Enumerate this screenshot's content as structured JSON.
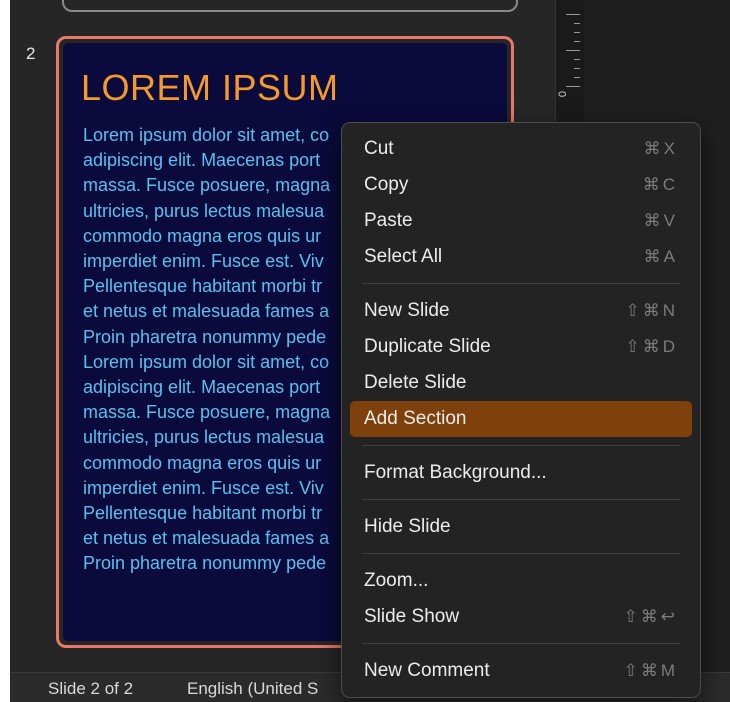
{
  "navigator": {
    "slide_number": "2",
    "slide_title": "LOREM IPSUM",
    "slide_body_lines": [
      "Lorem ipsum dolor sit amet, co",
      "adipiscing elit. Maecenas port",
      "massa. Fusce posuere, magna",
      "ultricies, purus lectus malesua",
      "commodo magna eros quis ur",
      "imperdiet enim. Fusce est. Viv",
      "Pellentesque habitant morbi tr",
      "et netus et malesuada fames a",
      "Proin pharetra nonummy pede",
      "Lorem ipsum dolor sit amet, co",
      "adipiscing elit. Maecenas port",
      "massa. Fusce posuere, magna",
      "ultricies, purus lectus malesua",
      "commodo magna eros quis ur",
      "imperdiet enim. Fusce est. Viv",
      "Pellentesque habitant morbi tr",
      "et netus et malesuada fames a",
      "Proin pharetra nonummy pede"
    ]
  },
  "ruler": {
    "zero_label": "0"
  },
  "status_bar": {
    "slide_count": "Slide 2 of 2",
    "language": "English (United S"
  },
  "context_menu": {
    "groups": [
      [
        {
          "label": "Cut",
          "shortcut": "⌘X"
        },
        {
          "label": "Copy",
          "shortcut": "⌘C"
        },
        {
          "label": "Paste",
          "shortcut": "⌘V"
        },
        {
          "label": "Select All",
          "shortcut": "⌘A"
        }
      ],
      [
        {
          "label": "New Slide",
          "shortcut": "⇧⌘N"
        },
        {
          "label": "Duplicate Slide",
          "shortcut": "⇧⌘D"
        },
        {
          "label": "Delete Slide",
          "shortcut": ""
        },
        {
          "label": "Add Section",
          "shortcut": "",
          "highlighted": true
        }
      ],
      [
        {
          "label": "Format Background...",
          "shortcut": ""
        }
      ],
      [
        {
          "label": "Hide Slide",
          "shortcut": ""
        }
      ],
      [
        {
          "label": "Zoom...",
          "shortcut": ""
        },
        {
          "label": "Slide Show",
          "shortcut": "⇧⌘↩"
        }
      ],
      [
        {
          "label": "New Comment",
          "shortcut": "⇧⌘M"
        }
      ]
    ]
  },
  "colors": {
    "accent_highlight": "#7e410c",
    "slide_border": "#e8786a",
    "slide_title": "#f39a2d",
    "slide_body": "#56c2f0",
    "slide_background": "#0b0a3c"
  }
}
